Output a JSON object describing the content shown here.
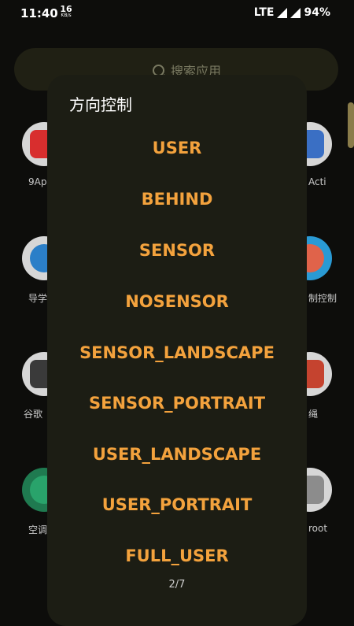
{
  "status_bar": {
    "time": "11:40",
    "speed_value": "16",
    "speed_unit": "KB/s",
    "network": "LTE",
    "battery": "94%"
  },
  "search": {
    "placeholder": "搜索应用"
  },
  "background_apps": {
    "left_labels": [
      "9Ap",
      "导学",
      "谷歌",
      "空调"
    ],
    "right_labels": [
      "Acti",
      "制控制",
      "绳",
      "root"
    ]
  },
  "dialog": {
    "title": "方向控制",
    "options": [
      "USER",
      "BEHIND",
      "SENSOR",
      "NOSENSOR",
      "SENSOR_LANDSCAPE",
      "SENSOR_PORTRAIT",
      "USER_LANDSCAPE",
      "USER_PORTRAIT",
      "FULL_USER"
    ],
    "page_indicator": "2/7"
  },
  "colors": {
    "accent": "#f3a23d",
    "dialog_bg": "#1c1d14",
    "screen_bg": "#0d0d0b"
  },
  "icons": [
    "search-icon",
    "signal-icon",
    "app-icon"
  ]
}
